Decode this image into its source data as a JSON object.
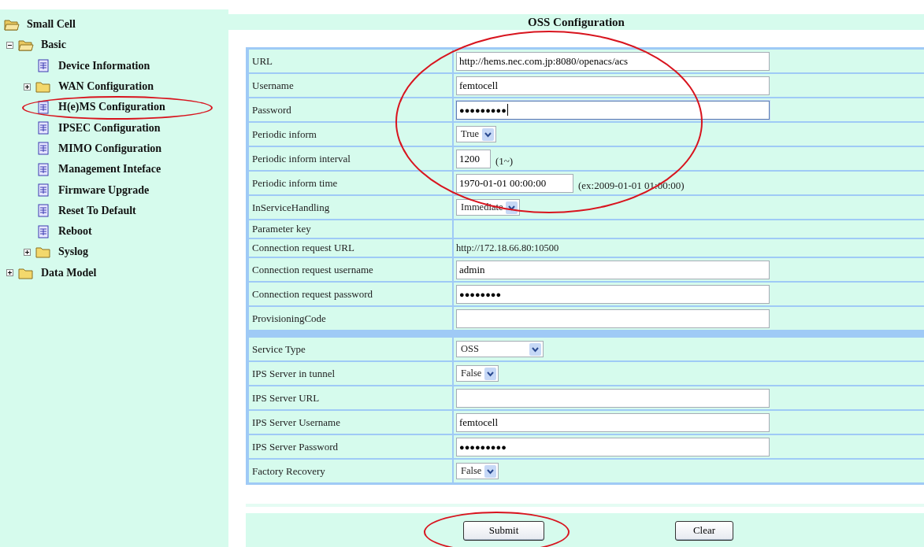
{
  "tree": {
    "label": "Small Cell",
    "kind": "folder",
    "expanded": true,
    "children": [
      {
        "label": "Basic",
        "kind": "folder",
        "expanded": true,
        "children": [
          {
            "label": "Device Information",
            "kind": "page"
          },
          {
            "label": "WAN Configuration",
            "kind": "folder",
            "expanded": false
          },
          {
            "label": "H(e)MS Configuration",
            "kind": "page",
            "circled": true
          },
          {
            "label": "IPSEC Configuration",
            "kind": "page"
          },
          {
            "label": "MIMO Configuration",
            "kind": "page"
          },
          {
            "label": "Management Inteface",
            "kind": "page"
          },
          {
            "label": "Firmware Upgrade",
            "kind": "page"
          },
          {
            "label": "Reset To Default",
            "kind": "page"
          },
          {
            "label": "Reboot",
            "kind": "page"
          },
          {
            "label": "Syslog",
            "kind": "folder",
            "expanded": false
          }
        ]
      },
      {
        "label": "Data Model",
        "kind": "folder",
        "expanded": false
      }
    ]
  },
  "title": "OSS Configuration",
  "form": {
    "circled": true,
    "sections": [
      {
        "rows": [
          {
            "label": "URL",
            "kind": "text",
            "value": "http://hems.nec.com.jp:8080/openacs/acs"
          },
          {
            "label": "Username",
            "kind": "text",
            "value": "femtocell"
          },
          {
            "label": "Password",
            "kind": "password",
            "value": "●●●●●●●●●",
            "focused": true
          },
          {
            "label": "Periodic inform",
            "kind": "select",
            "value": "True"
          },
          {
            "label": "Periodic inform interval",
            "kind": "text",
            "value": "1200",
            "hint": "(1~)"
          },
          {
            "label": "Periodic inform time",
            "kind": "text",
            "value": "1970-01-01 00:00:00",
            "hint": "(ex:2009-01-01 01:00:00)"
          },
          {
            "label": "InServiceHandling",
            "kind": "select",
            "value": "Immediate"
          },
          {
            "label": "Parameter key",
            "kind": "static"
          },
          {
            "label": "Connection request URL",
            "kind": "static",
            "value": "http://172.18.66.80:10500"
          },
          {
            "label": "Connection request username",
            "kind": "text",
            "value": "admin"
          },
          {
            "label": "Connection request password",
            "kind": "password",
            "value": "●●●●●●●●",
            "focused": false
          },
          {
            "label": "ProvisioningCode",
            "kind": "text"
          }
        ]
      },
      {
        "rows": [
          {
            "label": "Service Type",
            "kind": "select",
            "value": "OSS"
          },
          {
            "label": "IPS Server in tunnel",
            "kind": "select",
            "value": "False"
          },
          {
            "label": "IPS Server URL",
            "kind": "text"
          },
          {
            "label": "IPS Server Username",
            "kind": "text",
            "value": "femtocell"
          },
          {
            "label": "IPS Server Password",
            "kind": "password",
            "value": "●●●●●●●●●",
            "focused": false
          },
          {
            "label": "Factory Recovery",
            "kind": "select",
            "value": "False"
          }
        ]
      }
    ]
  },
  "buttons": [
    {
      "label": "Submit",
      "circled": true
    },
    {
      "label": "Clear"
    }
  ]
}
